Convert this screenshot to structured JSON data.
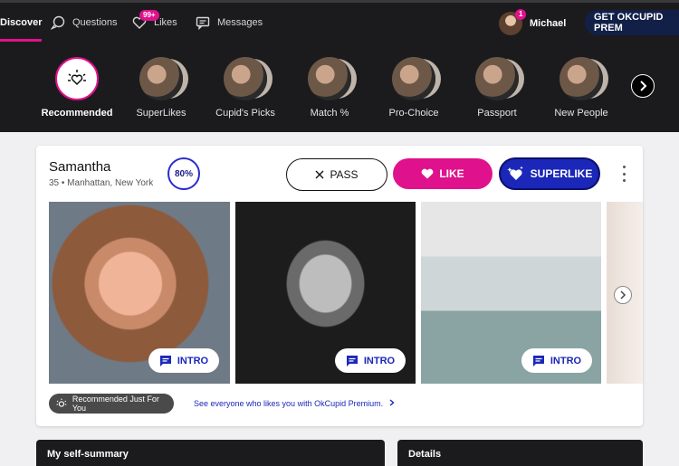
{
  "nav": {
    "items": [
      {
        "label": "Discover",
        "icon": "compass-icon"
      },
      {
        "label": "Questions",
        "icon": "question-bubble-icon"
      },
      {
        "label": "Likes",
        "icon": "heart-icon",
        "badge": "99+"
      },
      {
        "label": "Messages",
        "icon": "chat-icon"
      }
    ],
    "user": {
      "name": "Michael",
      "badge": "1"
    },
    "premium_label": "GET OKCUPID PREM"
  },
  "stories": [
    {
      "label": "Recommended"
    },
    {
      "label": "SuperLikes"
    },
    {
      "label": "Cupid's Picks"
    },
    {
      "label": "Match %"
    },
    {
      "label": "Pro-Choice"
    },
    {
      "label": "Passport"
    },
    {
      "label": "New People"
    }
  ],
  "profile": {
    "name": "Samantha",
    "sub": "35 • Manhattan, New York",
    "match": "80%",
    "pass_label": "PASS",
    "like_label": "LIKE",
    "superlike_label": "SUPERLIKE",
    "intro_label": "INTRO",
    "recommended_label": "Recommended Just For You",
    "premium_link": "See everyone who likes you with OkCupid Premium."
  },
  "panels": {
    "left_title": "My self-summary",
    "right_title": "Details"
  },
  "colors": {
    "nav_bg": "#1b1b1d",
    "accent_pink": "#e0118c",
    "accent_blue": "#1b27b8"
  }
}
